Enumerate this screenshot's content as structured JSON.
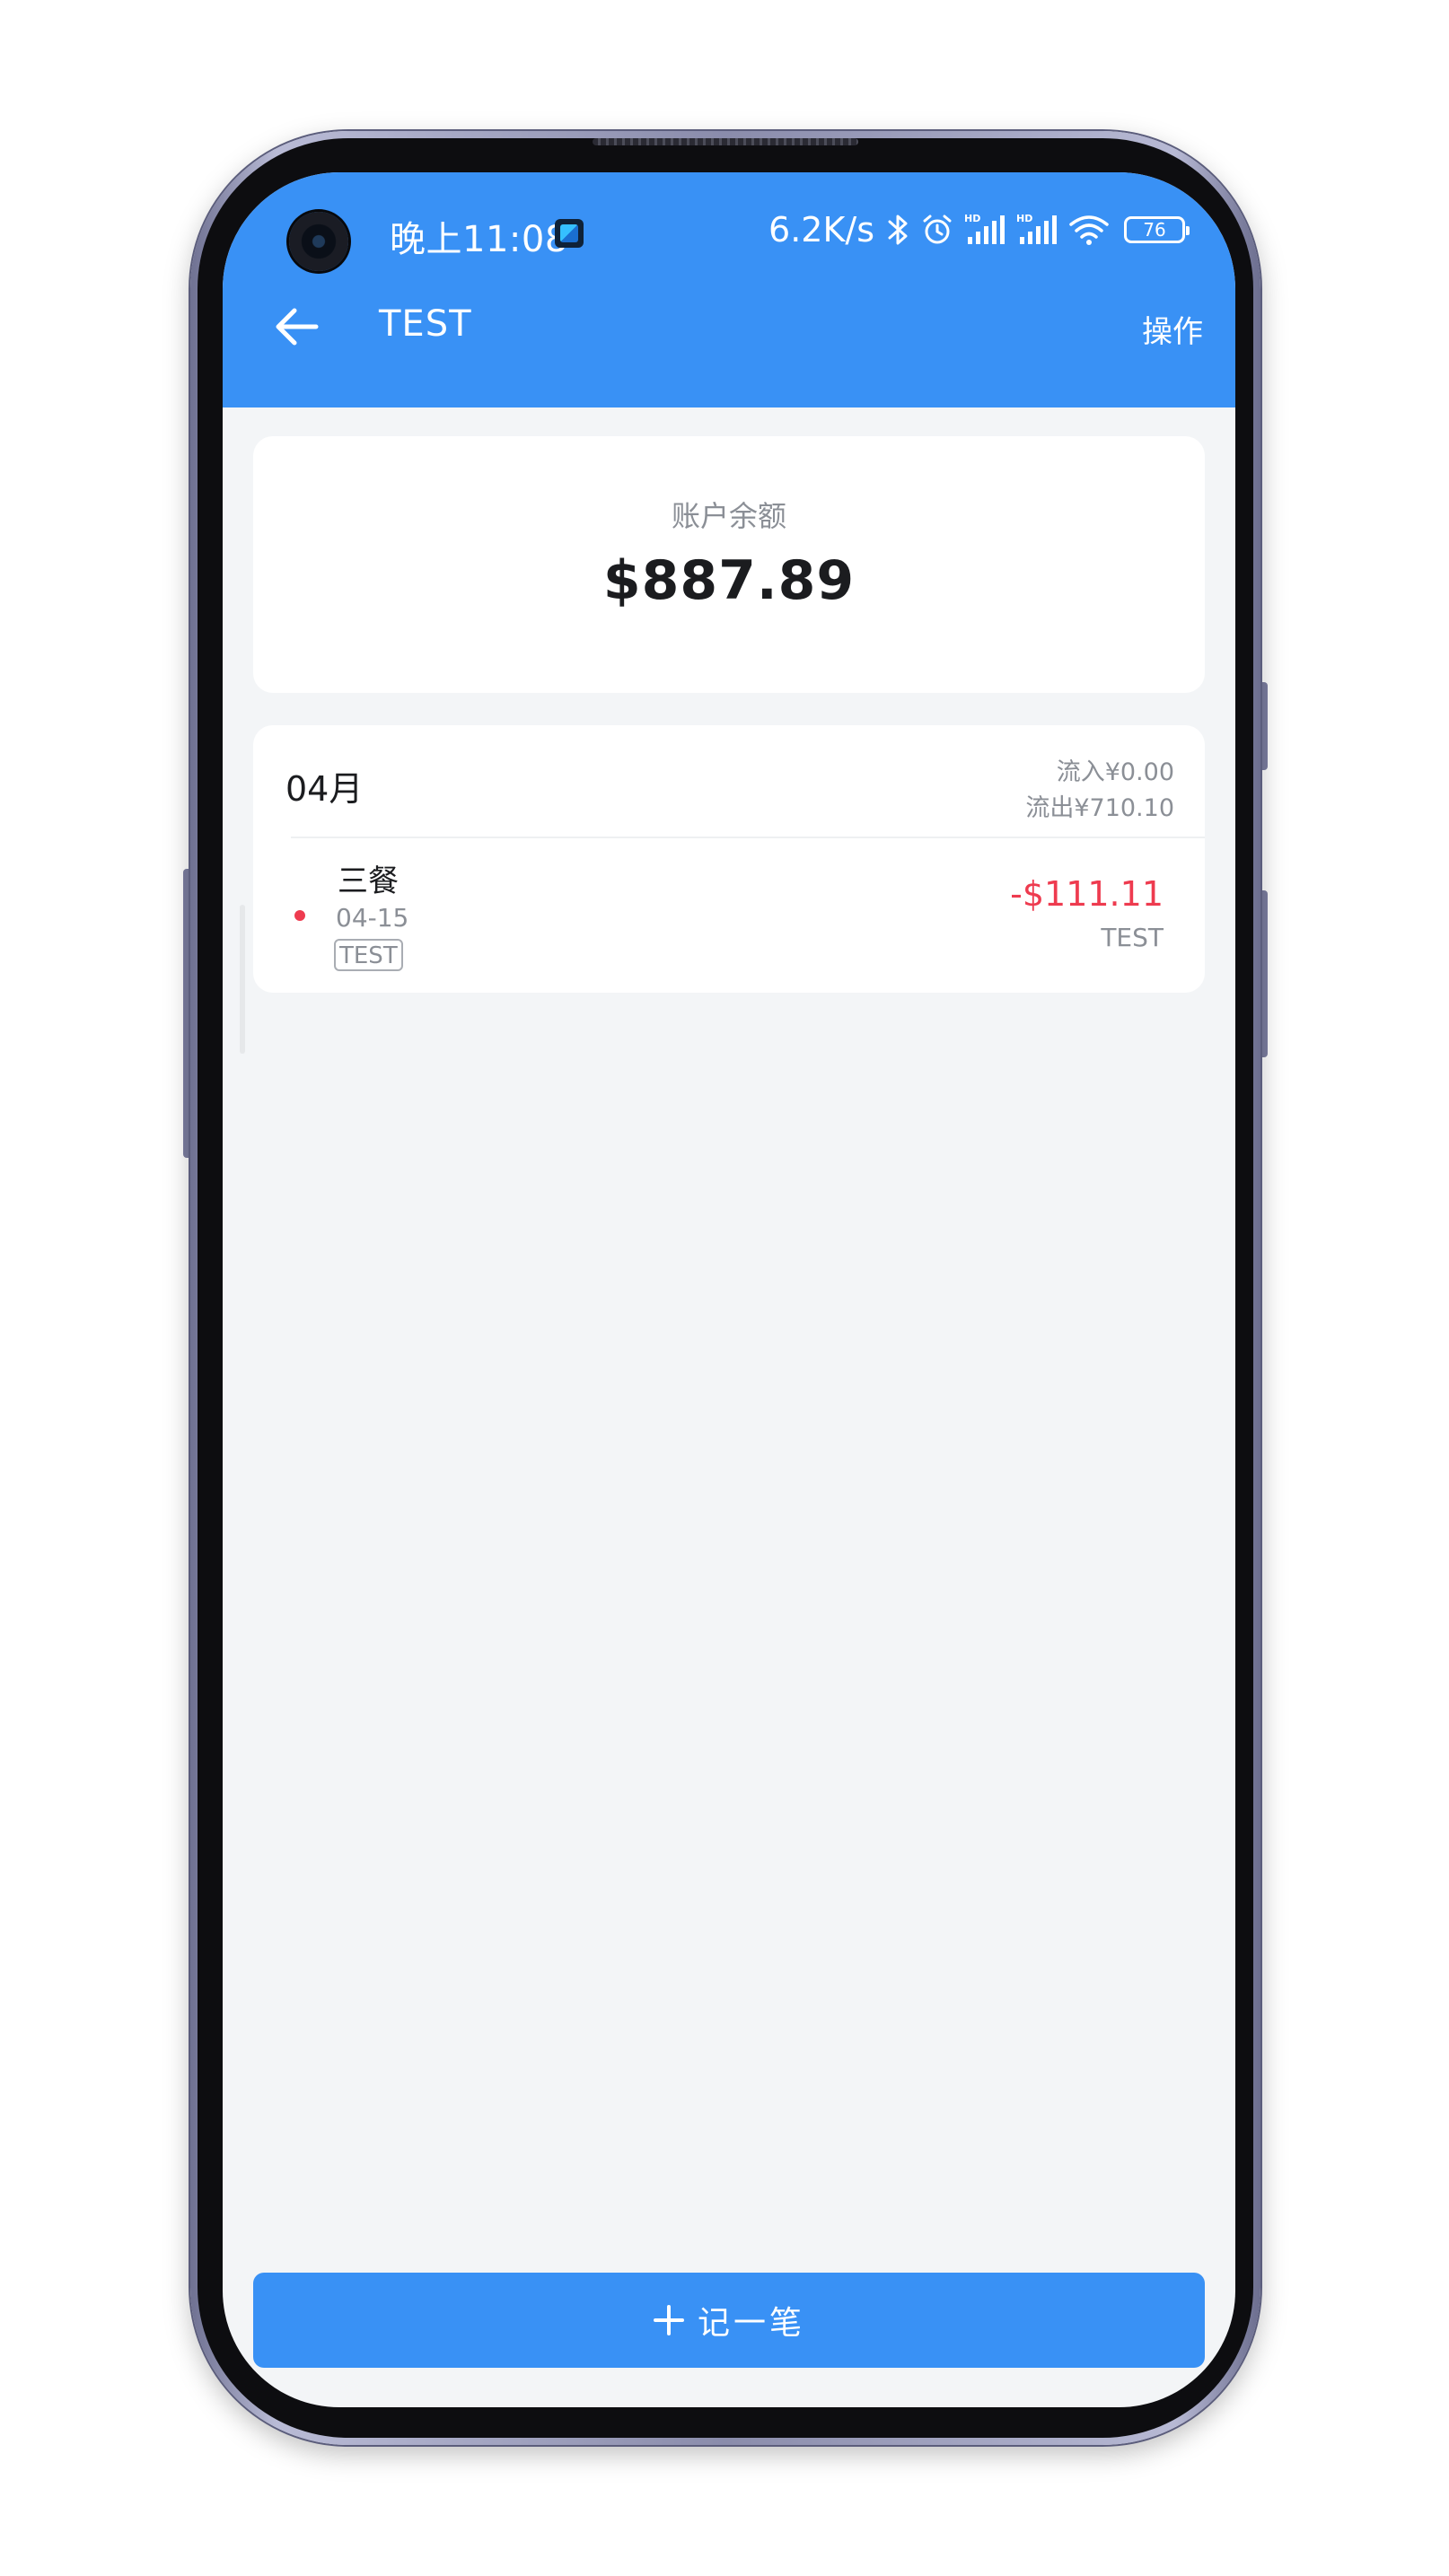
{
  "status_bar": {
    "time": "晚上11:08",
    "network_speed": "6.2K/s",
    "battery_level": "76",
    "icons": [
      "notification-app-icon",
      "bluetooth-icon",
      "alarm-icon",
      "hd-signal-icon",
      "hd-signal-icon",
      "wifi-icon",
      "battery-icon"
    ]
  },
  "toolbar": {
    "title": "TEST",
    "action_label": "操作",
    "back_icon": "arrow-left-icon"
  },
  "balance": {
    "label": "账户余额",
    "value": "$887.89"
  },
  "month_group": {
    "month": "04月",
    "inflow": "流入¥0.00",
    "outflow": "流出¥710.10",
    "transactions": [
      {
        "category": "三餐",
        "date": "04-15",
        "tag": "TEST",
        "amount": "-$111.11",
        "account": "TEST"
      }
    ]
  },
  "add_button": {
    "label": "记一笔",
    "icon": "plus-icon"
  },
  "colors": {
    "primary": "#3991f5",
    "expense": "#ee3b4f",
    "background": "#f3f5f7",
    "muted_text": "#8b8f96"
  }
}
